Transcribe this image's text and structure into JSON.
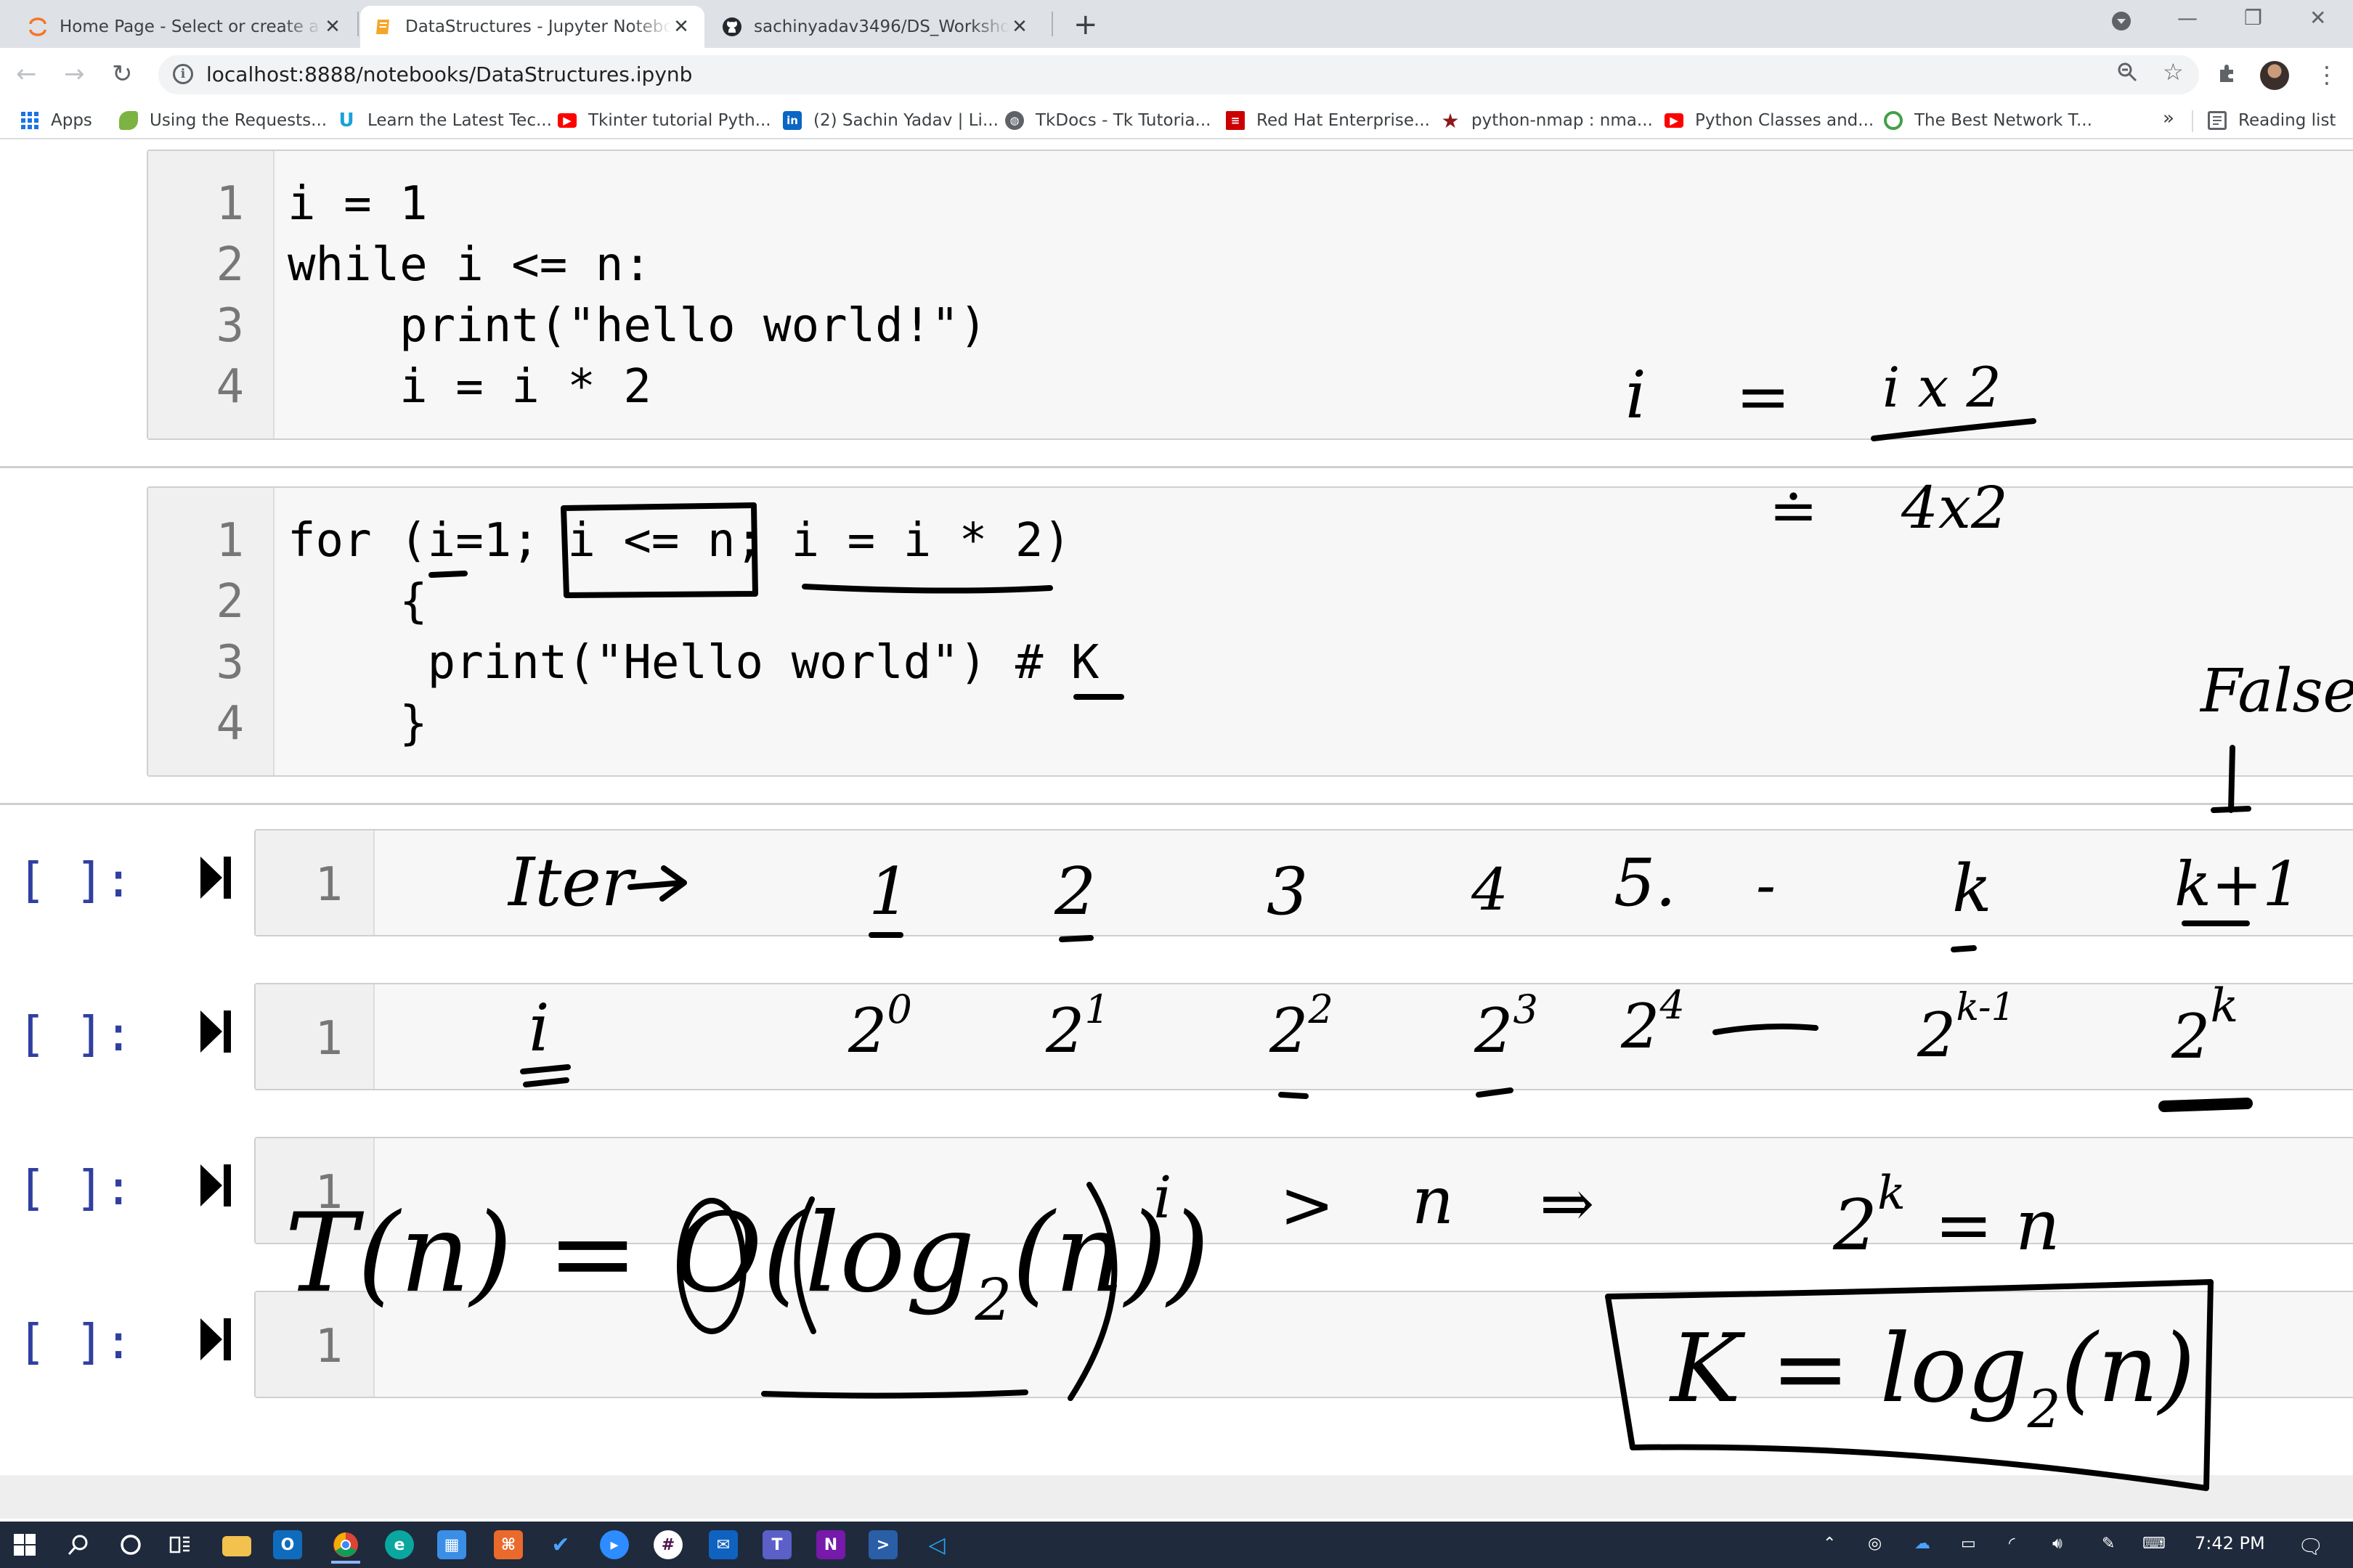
{
  "browser": {
    "tabs": [
      {
        "title": "Home Page - Select or create a n",
        "close": "✕"
      },
      {
        "title": "DataStructures - Jupyter Notebo",
        "close": "✕"
      },
      {
        "title": "sachinyadav3496/DS_Workshop",
        "close": "✕"
      }
    ],
    "new_tab": "+",
    "window_controls": {
      "minimize": "—",
      "restore": "❐",
      "close": "✕"
    },
    "nav": {
      "back": "←",
      "forward": "→",
      "reload": "↻"
    },
    "url": "localhost:8888/notebooks/DataStructures.ipynb",
    "toolbar_icons": {
      "zoom": "🔍",
      "star": "☆",
      "extensions": "✱",
      "menu": "⋮"
    }
  },
  "bookmarks": {
    "items": [
      {
        "label": "Apps",
        "icon": "apps-grid-icon"
      },
      {
        "label": "Using the Requests...",
        "icon": "leaf-icon"
      },
      {
        "label": "Learn the Latest Tec...",
        "icon": "udemy-icon"
      },
      {
        "label": "Tkinter tutorial Pyth...",
        "icon": "youtube-icon"
      },
      {
        "label": "(2) Sachin Yadav | Li...",
        "icon": "linkedin-icon"
      },
      {
        "label": "TkDocs - Tk Tutoria...",
        "icon": "globe-icon"
      },
      {
        "label": "Red Hat Enterprise...",
        "icon": "redhat-icon"
      },
      {
        "label": "python-nmap : nma...",
        "icon": "star-badge-icon"
      },
      {
        "label": "Python Classes and...",
        "icon": "youtube-icon"
      },
      {
        "label": "The Best Network T...",
        "icon": "green-circle-icon"
      }
    ],
    "more": "»",
    "reading_list": "Reading list"
  },
  "notebook": {
    "cell1": {
      "line_numbers": [
        "1",
        "2",
        "3",
        "4"
      ],
      "lines": [
        "i = 1",
        "while i <= n:",
        "    print(\"hello world!\")",
        "    i = i * 2"
      ]
    },
    "cell2": {
      "line_numbers": [
        "1",
        "2",
        "3",
        "4"
      ],
      "lines": [
        "for (i=1; i <= n; i = i * 2)",
        "    {",
        "     print(\"Hello world\") # K",
        "    }"
      ]
    },
    "empty_cells": [
      {
        "prompt": "[ ]:",
        "line_number": "1"
      },
      {
        "prompt": "[ ]:",
        "line_number": "1"
      },
      {
        "prompt": "[ ]:",
        "line_number": "1"
      },
      {
        "prompt": "[ ]:",
        "line_number": "1"
      }
    ]
  },
  "handwriting": {
    "iter_label": "Iter",
    "iterations": [
      "1",
      "2",
      "3",
      "4",
      "5.",
      "-",
      "k",
      "k+1"
    ],
    "i_label": "i",
    "powers_base": "2",
    "powers_exp": [
      "0",
      "1",
      "2",
      "3",
      "4",
      "k-1",
      "k"
    ],
    "eq_i_lhs": "i",
    "eq_i_equals": "=",
    "eq_i_rhs": "i x 2",
    "eq_i_dot_equals": "≐",
    "eq_i_rhs2": "4x2",
    "false_label": "False",
    "down_arrow": "↓",
    "condition_lhs": "i",
    "condition_op": ">",
    "condition_rhs": "n",
    "implies": "⇒",
    "two_pow_k": "2",
    "k_sup": "k",
    "equals_n": "= n",
    "tn_label": "T(n) = O(log",
    "tn_sub": "2",
    "tn_tail": "(n))",
    "k_eq": "K = log",
    "k_sub": "2",
    "k_tail": "(n)"
  },
  "taskbar": {
    "time": "7:42 PM"
  }
}
